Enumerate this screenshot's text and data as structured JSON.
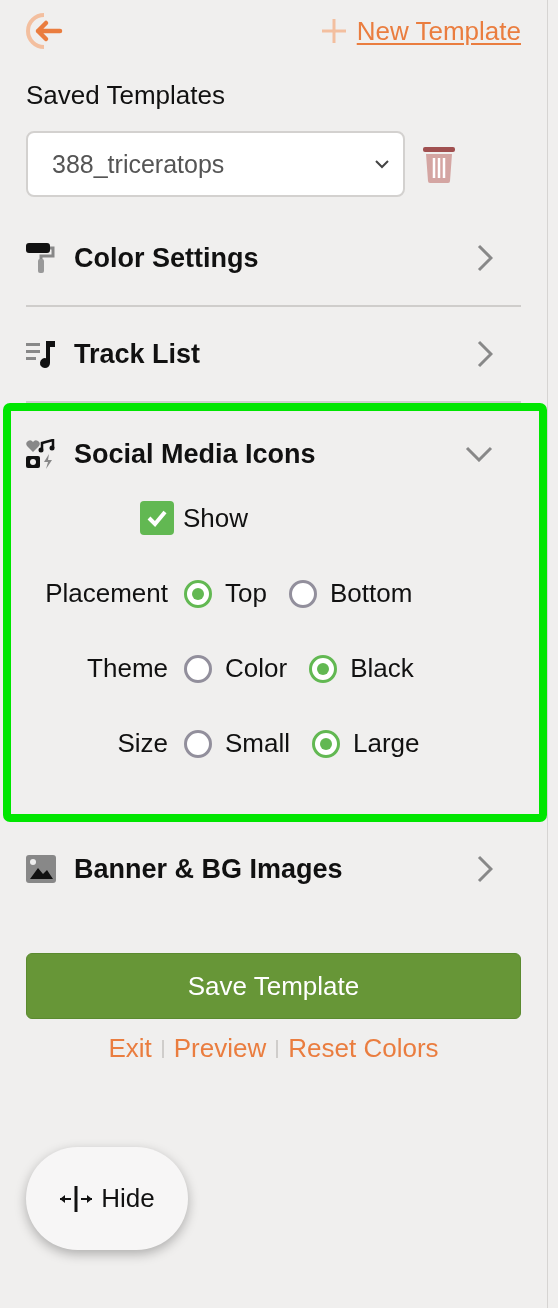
{
  "header": {
    "new_template_link": "New Template"
  },
  "saved_templates": {
    "label": "Saved Templates",
    "value": "388_triceratops"
  },
  "sections": [
    {
      "kind": "roller",
      "title": "Color Settings",
      "expanded": false,
      "highlighted": false
    },
    {
      "kind": "tracks",
      "title": "Track List",
      "expanded": false,
      "highlighted": false
    },
    {
      "kind": "social",
      "title": "Social Media Icons",
      "expanded": true,
      "highlighted": true,
      "show": {
        "label": "Show",
        "checked": true
      },
      "options": [
        {
          "label": "Placement",
          "choices": [
            {
              "label": "Top",
              "selected": true
            },
            {
              "label": "Bottom",
              "selected": false
            }
          ]
        },
        {
          "label": "Theme",
          "choices": [
            {
              "label": "Color",
              "selected": false
            },
            {
              "label": "Black",
              "selected": true
            }
          ]
        },
        {
          "label": "Size",
          "choices": [
            {
              "label": "Small",
              "selected": false
            },
            {
              "label": "Large",
              "selected": true
            }
          ]
        }
      ]
    },
    {
      "kind": "image",
      "title": "Banner & BG Images",
      "expanded": false,
      "highlighted": false
    }
  ],
  "save_button": "Save Template",
  "links": [
    "Exit",
    "Preview",
    "Reset Colors"
  ],
  "hide_button": "Hide"
}
